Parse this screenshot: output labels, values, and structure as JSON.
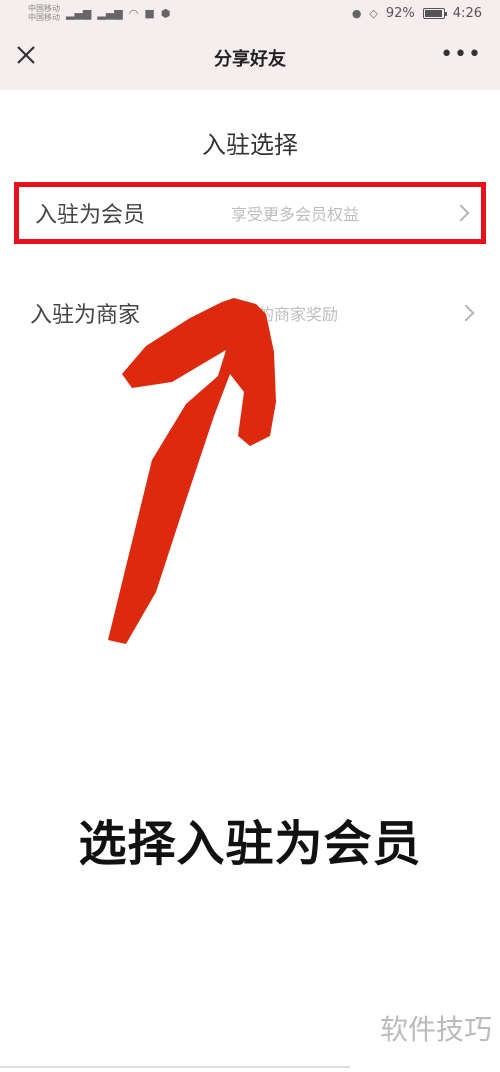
{
  "status_bar": {
    "carrier_1": "中国移动",
    "carrier_2": "中国移动",
    "battery": "92%",
    "time": "4:26",
    "battery_level": 0.92,
    "icons": [
      "signal-icon",
      "signal-icon",
      "wifi-icon",
      "camera-icon",
      "shield-icon",
      "mic-icon",
      "mute-icon",
      "battery-icon"
    ]
  },
  "nav": {
    "close_icon": "close-icon",
    "title": "分享好友",
    "more_icon": "more-icon"
  },
  "page": {
    "heading": "入驻选择"
  },
  "options": [
    {
      "label": "入驻为会员",
      "description": "享受更多会员权益",
      "highlighted": true
    },
    {
      "label": "入驻为商家",
      "description": "更多的商家奖励",
      "highlighted": false
    }
  ],
  "annotation": {
    "caption": "选择入驻为会员",
    "arrow_color": "#dd2a0f",
    "highlight_color": "#e8101a"
  },
  "watermark": "软件技巧"
}
